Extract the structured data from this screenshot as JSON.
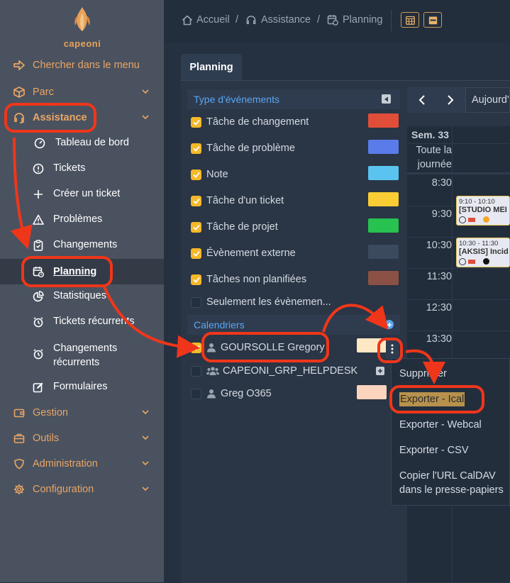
{
  "app": {
    "logo_text": "capeoni"
  },
  "sidebar": {
    "search": "Chercher dans le menu",
    "items": [
      {
        "label": "Parc",
        "icon": "cube-icon"
      },
      {
        "label": "Assistance",
        "icon": "headset-icon"
      },
      {
        "label": "Gestion",
        "icon": "wallet-icon"
      },
      {
        "label": "Outils",
        "icon": "briefcase-icon"
      },
      {
        "label": "Administration",
        "icon": "shield-icon"
      },
      {
        "label": "Configuration",
        "icon": "gear-icon"
      }
    ],
    "assistance_sub": [
      {
        "label": "Tableau de bord"
      },
      {
        "label": "Tickets"
      },
      {
        "label": "Créer un ticket"
      },
      {
        "label": "Problèmes"
      },
      {
        "label": "Changements"
      },
      {
        "label": "Planning"
      },
      {
        "label": "Statistiques"
      },
      {
        "label": "Tickets récurrents"
      },
      {
        "label": "Changements récurrents"
      },
      {
        "label": "Formulaires"
      }
    ]
  },
  "breadcrumb": [
    "Accueil",
    "Assistance",
    "Planning"
  ],
  "tab": {
    "label": "Planning"
  },
  "event_types": {
    "title": "Type d'événements",
    "items": [
      {
        "label": "Tâche de changement",
        "checked": true,
        "color": "#e04e3a"
      },
      {
        "label": "Tâche de problème",
        "checked": true,
        "color": "#5a7bea"
      },
      {
        "label": "Note",
        "checked": true,
        "color": "#5bc3f0"
      },
      {
        "label": "Tâche d'un ticket",
        "checked": true,
        "color": "#f9cd33"
      },
      {
        "label": "Tâche de projet",
        "checked": true,
        "color": "#27c24f"
      },
      {
        "label": "Évènement externe",
        "checked": true,
        "color": "#3b4a5d"
      },
      {
        "label": "Tâches non planifiées",
        "checked": true,
        "color": "#8b5144"
      },
      {
        "label": "Seulement les évènemen...",
        "checked": false,
        "color": ""
      }
    ]
  },
  "calendars": {
    "title": "Calendriers",
    "items": [
      {
        "label": "GOURSOLLE Gregory",
        "checked": true,
        "color": "#fde8c3"
      },
      {
        "label": "CAPEONI_GRP_HELPDESK",
        "checked": false,
        "color": ""
      },
      {
        "label": "Greg O365",
        "checked": false,
        "color": "#fcd3bd"
      }
    ]
  },
  "context_menu": [
    "Supprimer",
    "Exporter - Ical",
    "Exporter - Webcal",
    "Exporter - CSV",
    "Copier l'URL CalDAV\ndans le presse-papiers"
  ],
  "calendar": {
    "today_label": "Aujourd'",
    "week": "Sem. 33",
    "allday": "Toute la\njournée",
    "hours": [
      "8:30",
      "9:30",
      "10:30",
      "11:30",
      "12:30",
      "13:30"
    ],
    "events": [
      {
        "time": "9:10 - 10:10",
        "name": "[STUDIO MEI"
      },
      {
        "time": "10:30 - 11:30",
        "name": "[AKSIS] Incid"
      }
    ]
  },
  "colors": {
    "accent": "#e9a564",
    "annotation": "#f0361a",
    "checkbox": "#f5b829",
    "link": "#5aa6f0"
  }
}
